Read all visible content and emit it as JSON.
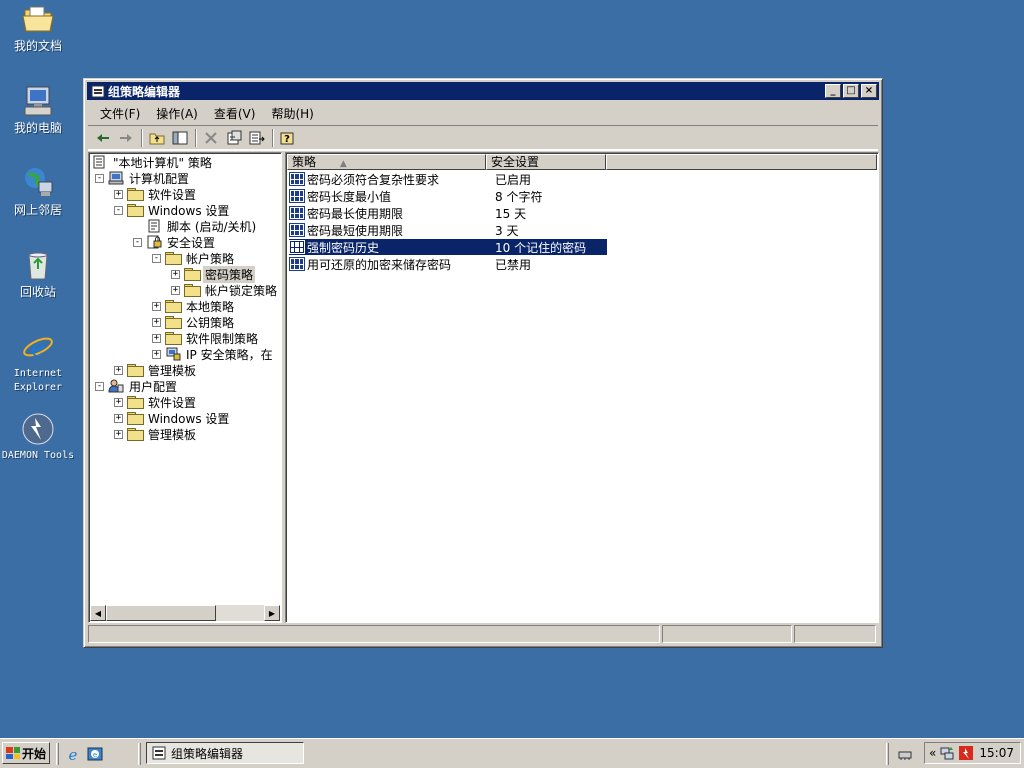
{
  "desktop": {
    "icons": [
      {
        "label": "我的文档",
        "icon": "my-documents-icon"
      },
      {
        "label": "我的电脑",
        "icon": "my-computer-icon"
      },
      {
        "label": "网上邻居",
        "icon": "network-places-icon"
      },
      {
        "label": "回收站",
        "icon": "recycle-bin-icon"
      },
      {
        "label": "Internet Explorer",
        "icon": "internet-explorer-icon"
      },
      {
        "label": "DAEMON Tools",
        "icon": "daemon-tools-icon"
      }
    ]
  },
  "window": {
    "title": "组策略编辑器",
    "controls": {
      "minimize": "_",
      "maximize": "□",
      "close": "×"
    },
    "menu": [
      "文件(F)",
      "操作(A)",
      "查看(V)",
      "帮助(H)"
    ],
    "toolbar": [
      "back-icon",
      "forward-icon",
      "up-folder-icon",
      "show-hide-tree-icon",
      "delete-icon",
      "properties-icon",
      "export-list-icon",
      "help-icon"
    ],
    "tree": {
      "root": "\"本地计算机\" 策略",
      "computer_config": "计算机配置",
      "software_settings": "软件设置",
      "windows_settings": "Windows 设置",
      "scripts": "脚本 (启动/关机)",
      "security_settings": "安全设置",
      "account_policies": "帐户策略",
      "password_policy": "密码策略",
      "lockout_policy": "帐户锁定策略",
      "local_policies": "本地策略",
      "public_key_policies": "公钥策略",
      "software_restriction": "软件限制策略",
      "ip_security": "IP 安全策略，在",
      "admin_templates": "管理模板",
      "user_config": "用户配置",
      "user_software_settings": "软件设置",
      "user_windows_settings": "Windows 设置",
      "user_admin_templates": "管理模板"
    },
    "list": {
      "columns": [
        "策略",
        "安全设置"
      ],
      "rows": [
        {
          "policy": "密码必须符合复杂性要求",
          "setting": "已启用"
        },
        {
          "policy": "密码长度最小值",
          "setting": "8 个字符"
        },
        {
          "policy": "密码最长使用期限",
          "setting": "15 天"
        },
        {
          "policy": "密码最短使用期限",
          "setting": "3 天"
        },
        {
          "policy": "强制密码历史",
          "setting": "10 个记住的密码",
          "selected": true
        },
        {
          "policy": "用可还原的加密来储存密码",
          "setting": "已禁用"
        }
      ]
    }
  },
  "taskbar": {
    "start_label": "开始",
    "quick_launch": [
      "internet-explorer-icon",
      "outlook-express-icon"
    ],
    "task_label": "组策略编辑器",
    "tray_icons": [
      "expand-tray-icon",
      "network-icon",
      "daemon-tray-icon"
    ],
    "clock": "15:07"
  },
  "colors": {
    "desktop": "#3a6ea5",
    "titlebar": "#0a246a",
    "face": "#d4d0c8",
    "selection": "#0a246a"
  }
}
